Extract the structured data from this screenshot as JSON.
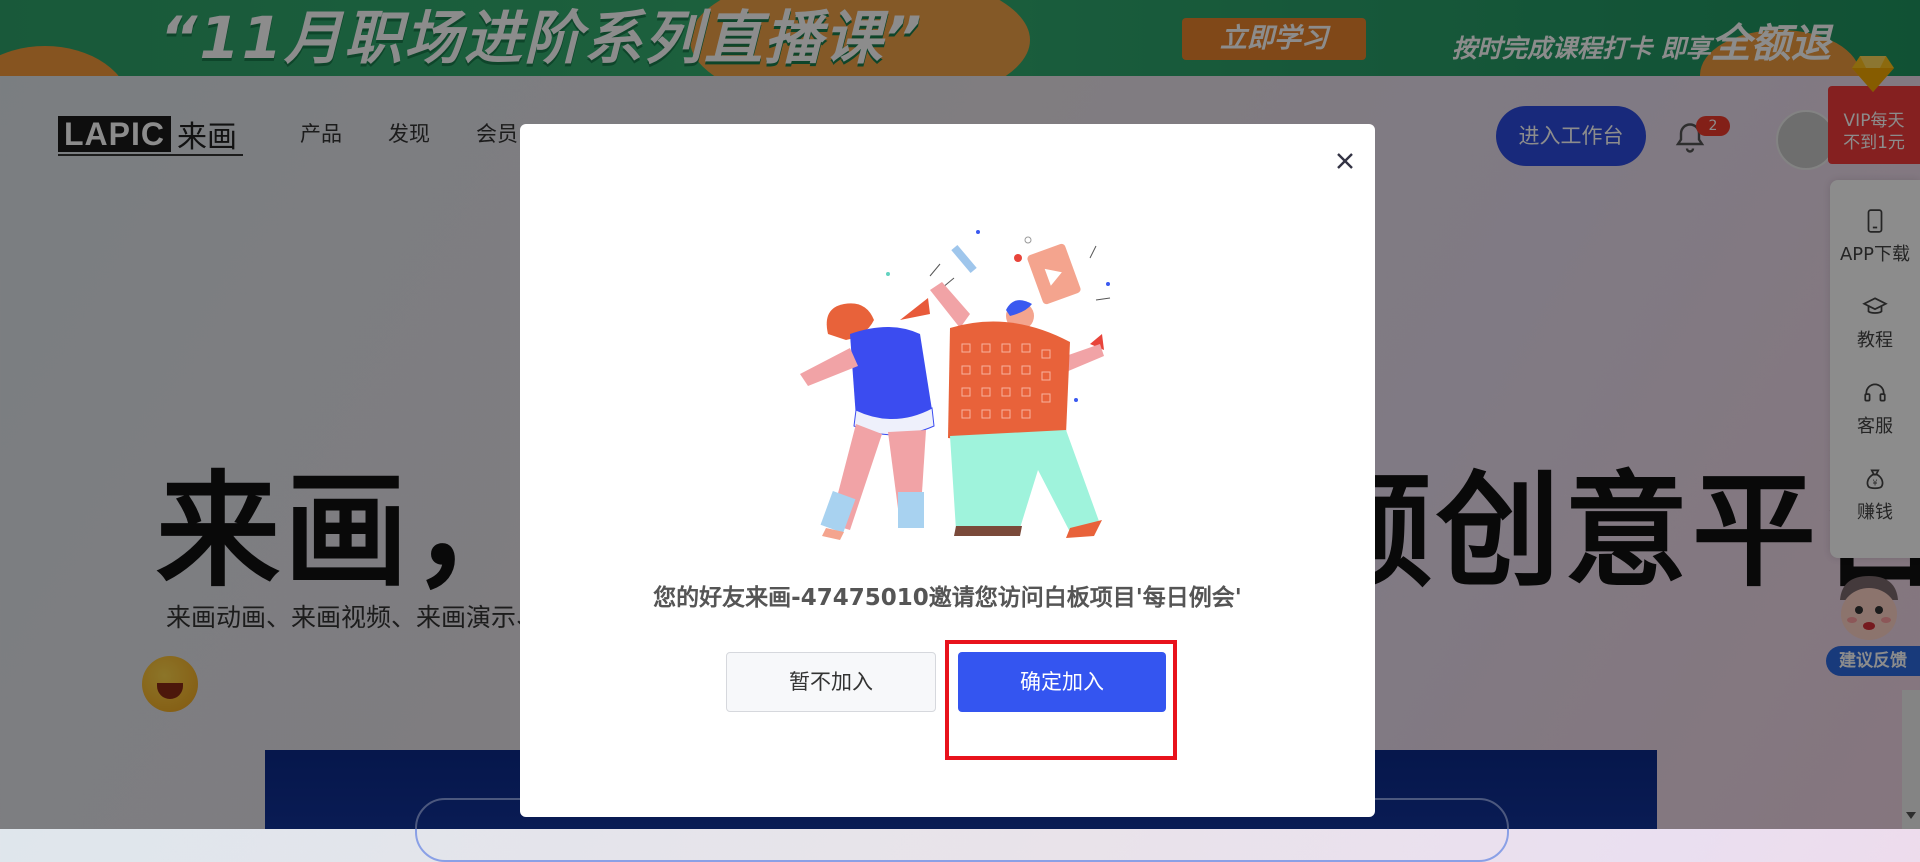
{
  "promo": {
    "title": "“11月职场进阶系列直播课”",
    "cta": "立即学习",
    "side_text_a": "按时完成课程打卡  即享",
    "side_text_b": "全额退"
  },
  "header": {
    "logo_mark": "LAPIC",
    "logo_cn": "来画",
    "nav": [
      "产品",
      "发现",
      "会员"
    ],
    "workbench_label": "进入工作台",
    "notification_count": "2"
  },
  "hero": {
    "title": "来画，一站式动画视频创意平台",
    "subtitle": "来画动画、来画视频、来画演示、来画白板等产品矩阵，全力为千万用户提供高效卓越服务"
  },
  "sidebar": {
    "vip_line1": "VIP每天",
    "vip_line2": "不到1元",
    "items": [
      {
        "label": "APP下载",
        "icon": "phone-icon"
      },
      {
        "label": "教程",
        "icon": "graduation-cap-icon"
      },
      {
        "label": "客服",
        "icon": "headset-icon"
      },
      {
        "label": "赚钱",
        "icon": "money-bag-icon"
      }
    ],
    "feedback_label": "建议反馈"
  },
  "modal": {
    "message": "您的好友来画-47475010邀请您访问白板项目'每日例会'",
    "decline_label": "暂不加入",
    "confirm_label": "确定加入"
  },
  "colors": {
    "primary": "#3455f0",
    "workbench": "#2d4be0",
    "highlight": "#e8121c",
    "vip": "#f23b3b",
    "promo_green": "#2ea36a"
  }
}
